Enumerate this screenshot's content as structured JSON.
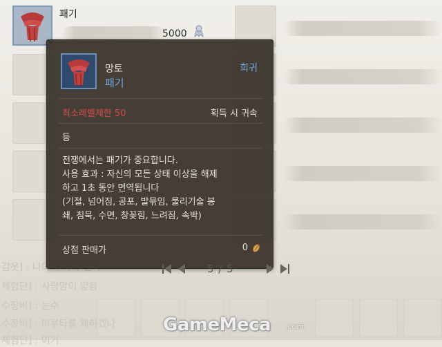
{
  "item": {
    "name": "패기",
    "price": "5000"
  },
  "tooltip": {
    "type": "망토",
    "name": "패기",
    "grade": "희귀",
    "level_req": "최소레벨제한 50",
    "binding": "획득 시 귀속",
    "grade_line": "등",
    "description": [
      "전쟁에서는 패기가 중요합니다.",
      "사용 효과 : 자신의 모든 상태 이상을 해제",
      "하고 1초 동안 면역됩니다",
      "(기절, 넘어짐, 공포, 발묶임, 물리기술 봉",
      "쇄, 침묵, 수면, 창꽂힘, 느려짐, 속박)"
    ],
    "shop_price_label": "상점 판매가",
    "shop_price_value": "0"
  },
  "pager": {
    "text": "5 / 5"
  },
  "background_text": {
    "line1": "감옷] : 나다의 바자 신지",
    "line2": "체험단] : 사람맘이 얇음",
    "line3": "수장비] : 눈수",
    "line4": "수장비] : 마루타를 왜하겠나",
    "line5": "체험단] : 이거"
  },
  "watermark": {
    "brand": "GameMeca",
    "suffix": ".com"
  },
  "colors": {
    "tooltip_bg": "#3a332c",
    "rare_blue": "#6fa6df",
    "level_red": "#d84a48"
  }
}
